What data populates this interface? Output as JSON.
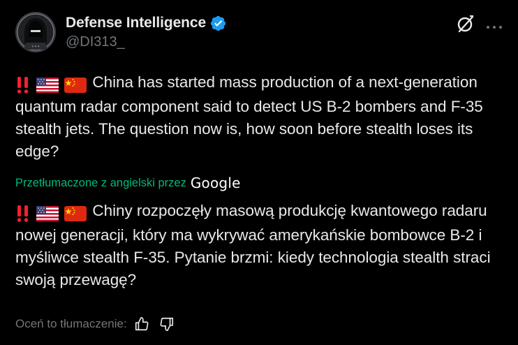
{
  "author": {
    "display_name": "Defense Intelligence",
    "handle": "@DI313_",
    "verified": true,
    "verified_color": "#1d9bf0"
  },
  "header_actions": {
    "grok_icon": "grok-icon",
    "more_icon": "more-dots-icon"
  },
  "tweet": {
    "original_text": "China has started mass production of a next-generation quantum radar component said to detect US B-2 bombers and F-35 stealth jets. The question now is, how soon before stealth loses its edge?",
    "original_emojis": [
      "double-exclamation-icon",
      "us-flag-icon",
      "china-flag-icon"
    ],
    "translated_by_label": "Przetłumaczone z angielski przez",
    "translator_brand": "Google",
    "translated_text": "Chiny rozpoczęły masową produkcję kwantowego radaru nowej generacji, który ma wykrywać amerykańskie bombowce B-2 i myśliwce stealth F-35. Pytanie brzmi: kiedy technologia stealth straci swoją przewagę?",
    "translated_emojis": [
      "double-exclamation-icon",
      "us-flag-icon",
      "china-flag-icon"
    ]
  },
  "rating": {
    "label": "Oceń to tłumaczenie:",
    "thumbs_up_icon": "thumbs-up-icon",
    "thumbs_down_icon": "thumbs-down-icon"
  },
  "colors": {
    "background": "#000000",
    "text_primary": "#e7e9ea",
    "text_secondary": "#71767b",
    "translation_link": "#00ba7c"
  }
}
